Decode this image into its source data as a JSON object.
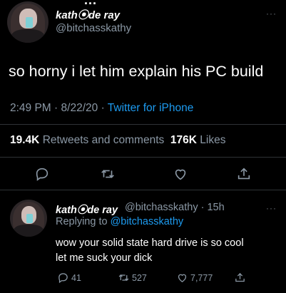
{
  "header_fragment": "...",
  "tweet": {
    "display_name": "kath⦿de ray",
    "handle": "@bitchasskathy",
    "more_icon": "more-icon",
    "text": "so horny i let him explain his PC build",
    "time": "2:49 PM",
    "date": "8/22/20",
    "separator": "·",
    "source": "Twitter for iPhone",
    "retweets_count": "19.4K",
    "retweets_label": "Retweets and comments",
    "likes_count": "176K",
    "likes_label": "Likes"
  },
  "reply": {
    "display_name": "kath⦿de ray",
    "handle": "@bitchasskathy",
    "age": "15h",
    "replying_prefix": "Replying to",
    "replying_handle": "@bitchasskathy",
    "line1": "wow your solid state hard drive is so cool",
    "line2": "let me suck your dick",
    "reply_count": "41",
    "retweet_count": "527",
    "like_count": "7,777"
  },
  "colors": {
    "background": "#000000",
    "text": "#ffffff",
    "secondary": "#8b98a5",
    "link": "#1d9bf0",
    "divider": "#2f3336"
  }
}
